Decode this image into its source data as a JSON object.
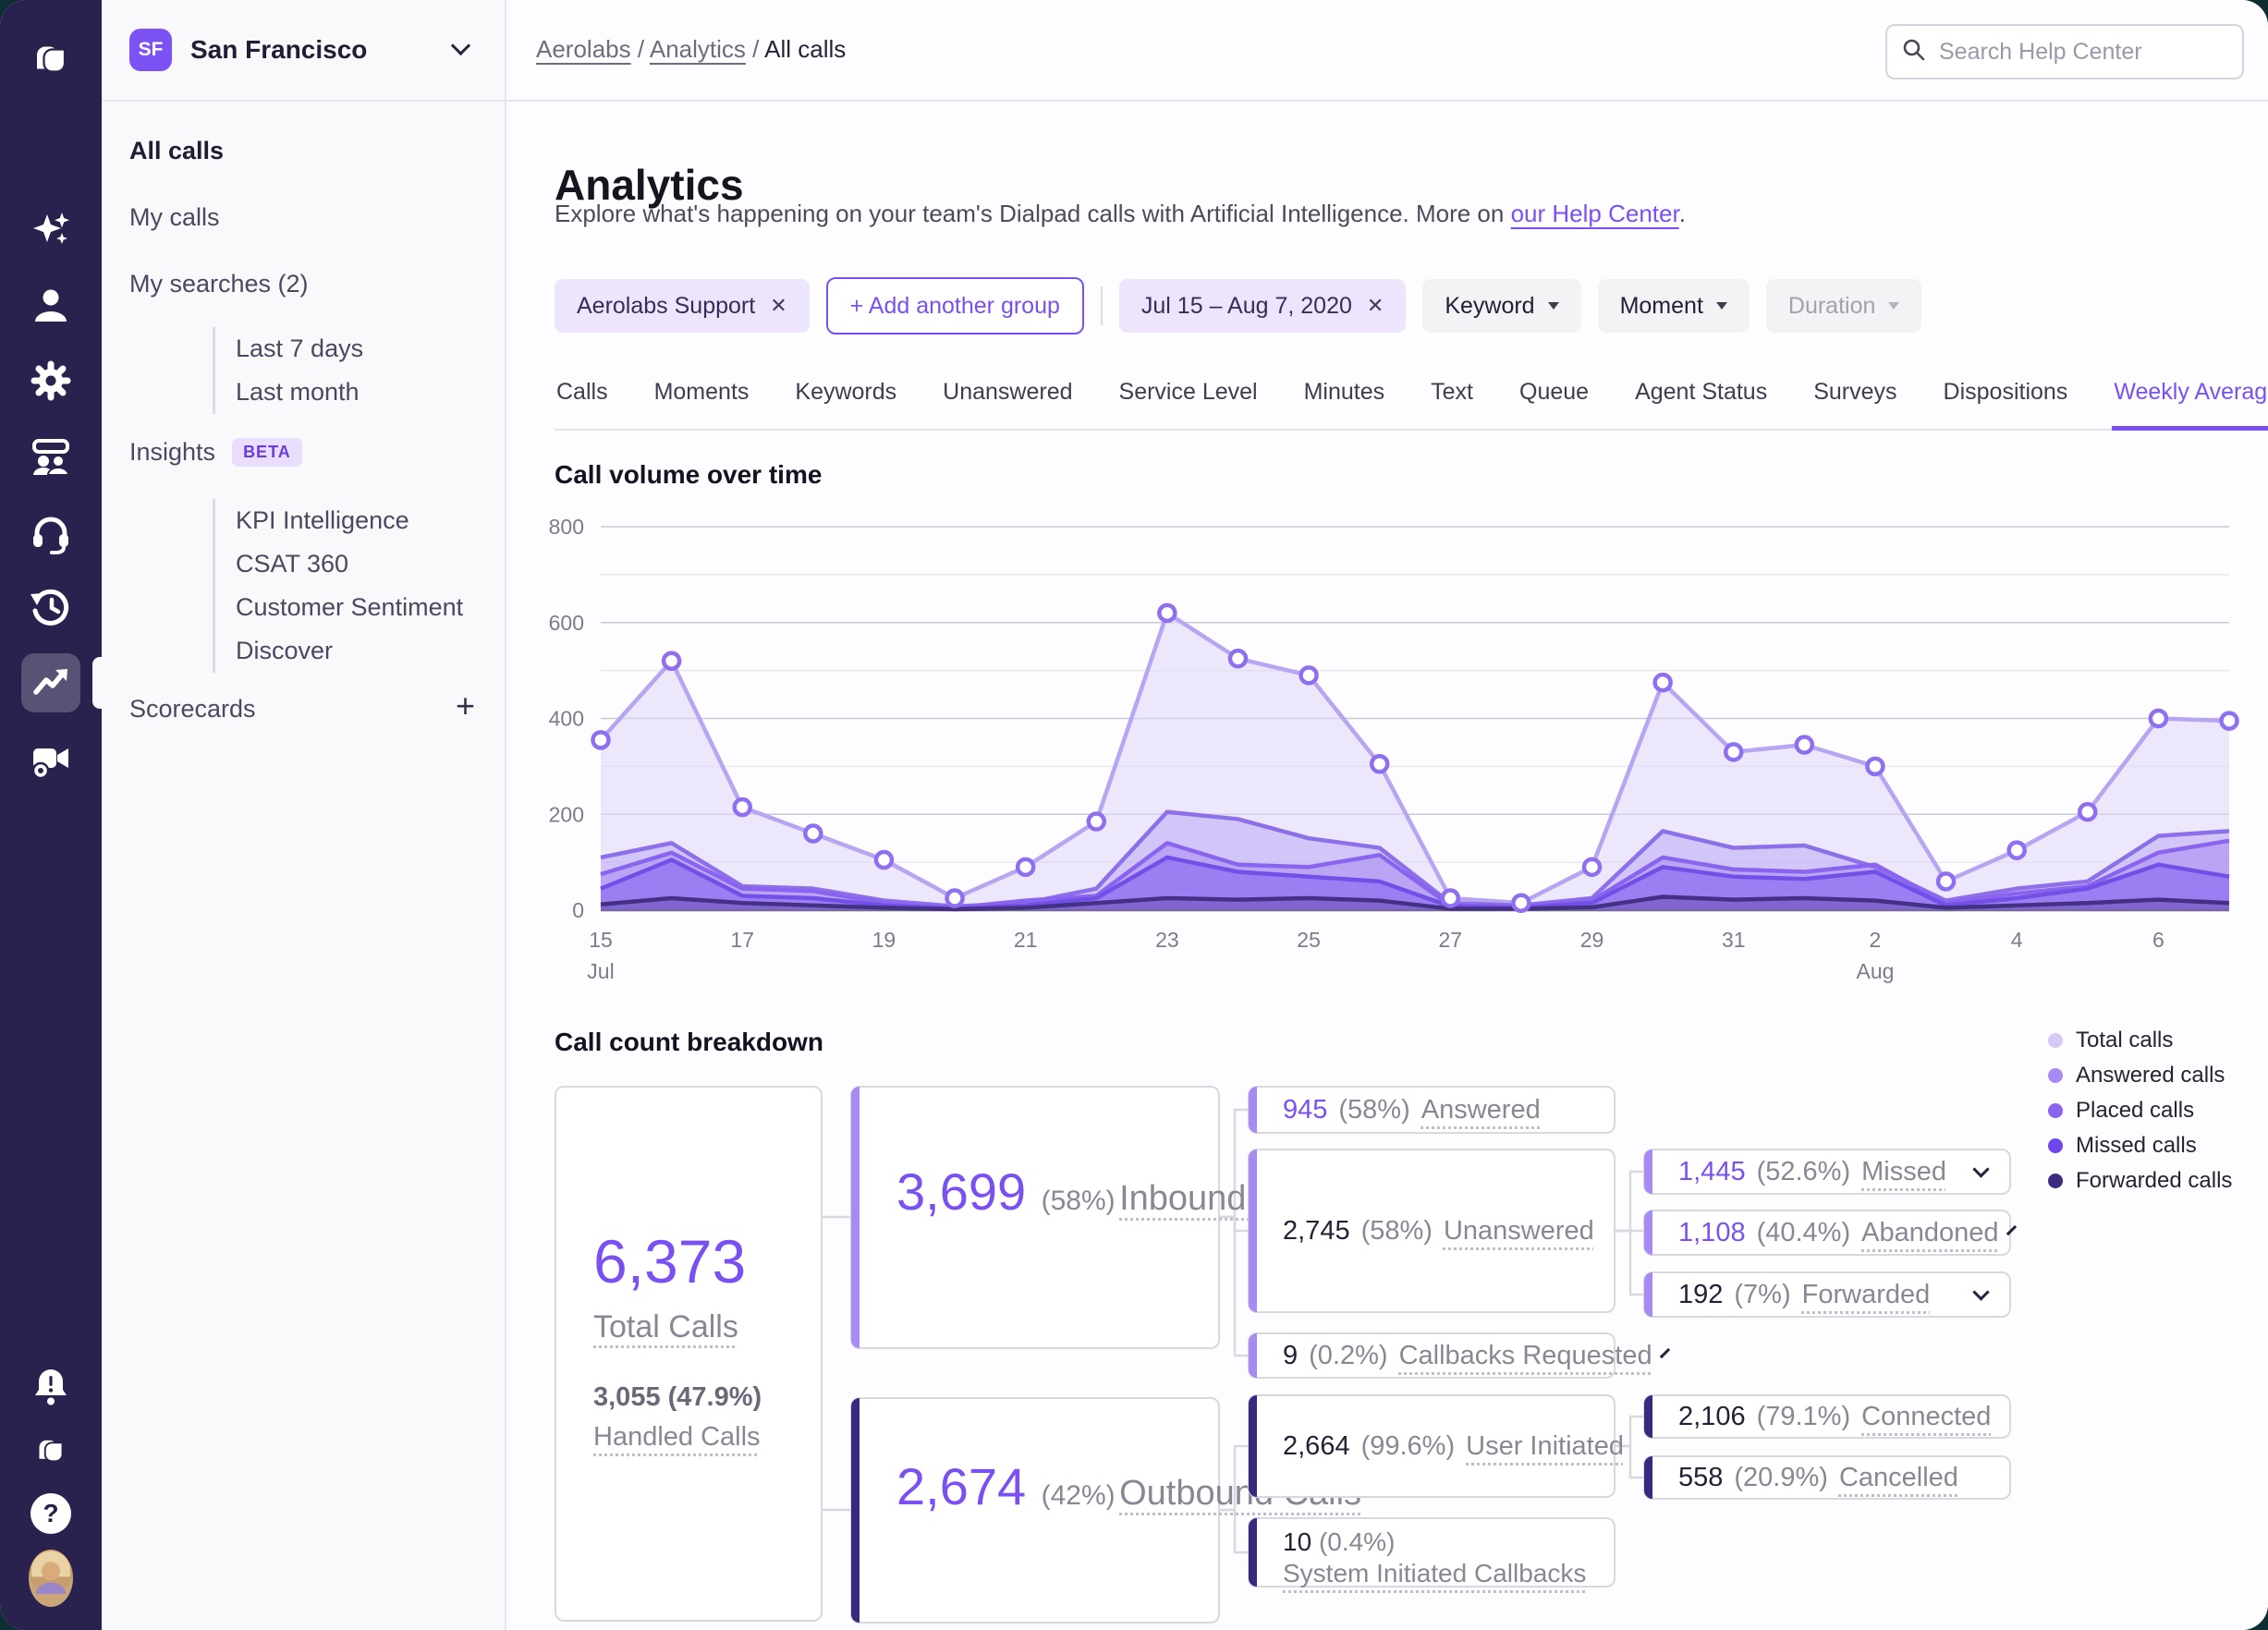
{
  "colors": {
    "accent": "#7b50f2",
    "rail_bg": "#29224f",
    "chip_purple_bg": "#ece5fb",
    "beta_badge_bg": "#e9defb",
    "beta_badge_text": "#6a3ddb",
    "card_border": "#d9d8e1",
    "accent_bar_light": "#a78bf3",
    "accent_bar_dark": "#372a7e"
  },
  "rail": {
    "icons": [
      "dialpad-logo",
      "ai-sparkles",
      "contacts",
      "settings",
      "coaching",
      "support-headset",
      "history",
      "analytics",
      "meetings",
      "notifications",
      "dialpad-logo-small",
      "help",
      "profile"
    ],
    "active": "analytics"
  },
  "workspace": {
    "initials": "SF",
    "name": "San Francisco"
  },
  "breadcrumb": {
    "link1": "Aerolabs",
    "link2": "Analytics",
    "current": "All calls",
    "separator": "/"
  },
  "search": {
    "placeholder": "Search Help Center"
  },
  "sidebar": {
    "all_calls": "All calls",
    "my_calls": "My calls",
    "my_searches": "My searches (2)",
    "searches": [
      "Last 7 days",
      "Last month"
    ],
    "insights": "Insights",
    "insights_badge": "BETA",
    "insight_items": [
      "KPI Intelligence",
      "CSAT 360",
      "Customer Sentiment",
      "Discover"
    ],
    "scorecards": "Scorecards",
    "scorecards_add": "+"
  },
  "page": {
    "title": "Analytics",
    "subtitle": "Explore what's happening on your team's Dialpad calls with Artificial Intelligence. More on ",
    "subtitle_link": "our Help Center",
    "subtitle_end": "."
  },
  "filters": {
    "group": "Aerolabs Support",
    "group_close": "✕",
    "add_group": "+  Add another group",
    "date_range": "Jul 15 – Aug 7, 2020",
    "date_close": "✕",
    "keyword": "Keyword",
    "moment": "Moment",
    "duration": "Duration"
  },
  "tabs": {
    "items": [
      "Calls",
      "Moments",
      "Keywords",
      "Unanswered",
      "Service Level",
      "Minutes",
      "Text",
      "Queue",
      "Agent Status",
      "Surveys",
      "Dispositions",
      "Weekly Averages"
    ],
    "active": "Weekly Averages"
  },
  "chart_data": {
    "type": "area",
    "title": "Call volume over time",
    "x": [
      "15",
      "16",
      "17",
      "18",
      "19",
      "20",
      "21",
      "22",
      "23",
      "24",
      "25",
      "26",
      "27",
      "28",
      "29",
      "30",
      "31",
      "1",
      "2",
      "3",
      "4",
      "5",
      "6",
      "7"
    ],
    "tick_every": 2,
    "month_labels": [
      {
        "index": 0,
        "label": "Jul"
      },
      {
        "index": 18,
        "label": "Aug"
      }
    ],
    "ylim": [
      0,
      800
    ],
    "y_ticks": [
      0,
      200,
      400,
      600,
      800
    ],
    "grid": "on",
    "legend_position": "right-of-breakdown",
    "series": [
      {
        "name": "Total calls",
        "line": "#b7a5f2",
        "fill": "rgba(223,214,248,0.55)",
        "markers": true,
        "values": [
          355,
          520,
          215,
          160,
          105,
          25,
          90,
          185,
          620,
          525,
          490,
          305,
          25,
          15,
          90,
          475,
          330,
          345,
          300,
          60,
          125,
          205,
          400,
          395
        ]
      },
      {
        "name": "Answered calls",
        "line": "#8d6fe9",
        "fill": "rgba(169,142,242,0.38)",
        "markers": false,
        "values": [
          110,
          140,
          50,
          45,
          20,
          8,
          15,
          45,
          205,
          190,
          150,
          130,
          15,
          10,
          25,
          165,
          130,
          135,
          90,
          20,
          45,
          60,
          155,
          165
        ]
      },
      {
        "name": "Placed calls",
        "line": "#8a64ee",
        "fill": "rgba(148,113,240,0.38)",
        "markers": false,
        "values": [
          75,
          120,
          45,
          40,
          15,
          5,
          20,
          30,
          140,
          95,
          90,
          115,
          10,
          8,
          20,
          110,
          85,
          80,
          95,
          15,
          35,
          50,
          120,
          145
        ]
      },
      {
        "name": "Missed calls",
        "line": "#7250e8",
        "fill": "rgba(129,95,238,0.55)",
        "markers": false,
        "values": [
          45,
          105,
          30,
          25,
          10,
          3,
          10,
          25,
          110,
          80,
          70,
          60,
          8,
          5,
          15,
          90,
          70,
          65,
          80,
          10,
          25,
          45,
          95,
          70
        ]
      },
      {
        "name": "Forwarded calls",
        "line": "#443084",
        "fill": "rgba(68,48,132,0.30)",
        "markers": false,
        "values": [
          12,
          25,
          15,
          10,
          5,
          2,
          5,
          15,
          25,
          22,
          25,
          20,
          3,
          3,
          6,
          28,
          22,
          25,
          20,
          5,
          10,
          15,
          22,
          15
        ]
      }
    ]
  },
  "breakdown": {
    "title": "Call count breakdown",
    "total": {
      "value": "6,373",
      "label": "Total Calls",
      "sub_value": "3,055 (47.9%)",
      "sub_label": "Handled Calls"
    },
    "inbound": {
      "value": "3,699",
      "pct": "(58%)",
      "label": "Inbound Calls"
    },
    "outbound": {
      "value": "2,674",
      "pct": "(42%)",
      "label": "Outbound Calls"
    },
    "answered": {
      "value": "945",
      "pct": "(58%)",
      "label": "Answered"
    },
    "unanswered": {
      "value": "2,745",
      "pct": "(58%)",
      "label": "Unanswered"
    },
    "callbacks": {
      "value": "9",
      "pct": "(0.2%)",
      "label": "Callbacks Requested"
    },
    "user_initiated": {
      "value": "2,664",
      "pct": "(99.6%)",
      "label": "User Initiated"
    },
    "system_callbacks": {
      "value": "10",
      "pct": "(0.4%)",
      "label": "System Initiated Callbacks"
    },
    "missed": {
      "value": "1,445",
      "pct": "(52.6%)",
      "label": "Missed"
    },
    "abandoned": {
      "value": "1,108",
      "pct": "(40.4%)",
      "label": "Abandoned"
    },
    "forwarded": {
      "value": "192",
      "pct": "(7%)",
      "label": "Forwarded"
    },
    "connected": {
      "value": "2,106",
      "pct": "(79.1%)",
      "label": "Connected"
    },
    "cancelled": {
      "value": "558",
      "pct": "(20.9%)",
      "label": "Cancelled"
    }
  },
  "legend": {
    "items": [
      {
        "label": "Total calls",
        "color": "#d7c9f6"
      },
      {
        "label": "Answered calls",
        "color": "#a78bf3"
      },
      {
        "label": "Placed calls",
        "color": "#8a64ee"
      },
      {
        "label": "Missed calls",
        "color": "#6f46ea"
      },
      {
        "label": "Forwarded calls",
        "color": "#3b2a80"
      }
    ]
  }
}
